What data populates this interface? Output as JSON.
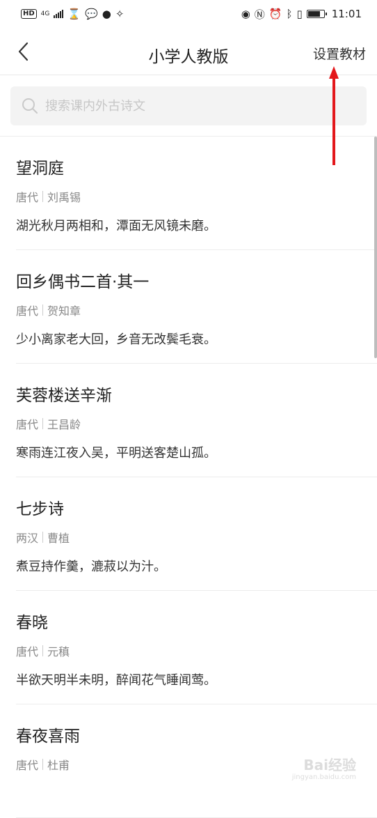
{
  "status_bar": {
    "hd": "HD",
    "signal_label": "4G",
    "time": "11:01"
  },
  "nav": {
    "title": "小学人教版",
    "action": "设置教材"
  },
  "search": {
    "placeholder": "搜索课内外古诗文"
  },
  "poems": [
    {
      "title": "望洞庭",
      "dynasty": "唐代",
      "author": "刘禹锡",
      "excerpt": "湖光秋月两相和，潭面无风镜未磨。"
    },
    {
      "title": "回乡偶书二首·其一",
      "dynasty": "唐代",
      "author": "贺知章",
      "excerpt": "少小离家老大回，乡音无改鬓毛衰。"
    },
    {
      "title": "芙蓉楼送辛渐",
      "dynasty": "唐代",
      "author": "王昌龄",
      "excerpt": "寒雨连江夜入吴，平明送客楚山孤。"
    },
    {
      "title": "七步诗",
      "dynasty": "两汉",
      "author": "曹植",
      "excerpt": "煮豆持作羹，漉菽以为汁。"
    },
    {
      "title": "春晓",
      "dynasty": "唐代",
      "author": "元稹",
      "excerpt": "半欲天明半未明，醉闻花气睡闻莺。"
    },
    {
      "title": "春夜喜雨",
      "dynasty": "唐代",
      "author": "杜甫",
      "excerpt": ""
    }
  ],
  "watermark": {
    "text": "Bai经验",
    "sub": "jingyan.baidu.com"
  },
  "colors": {
    "annotation_arrow": "#e3171b",
    "search_bg": "#f3f3f3"
  }
}
